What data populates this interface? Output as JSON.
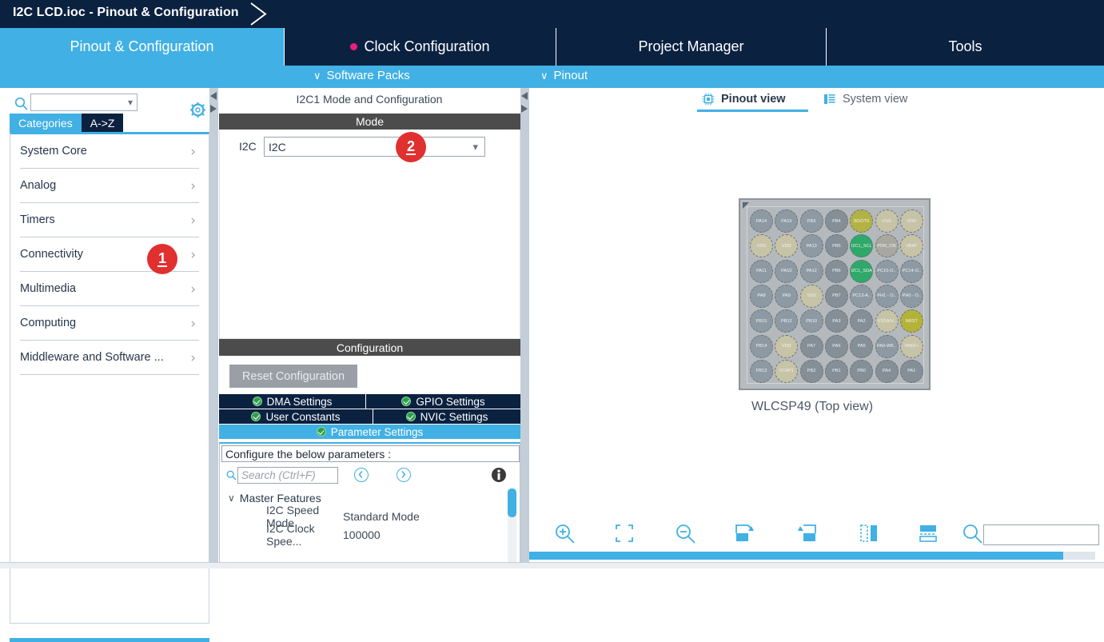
{
  "window": {
    "title": "I2C LCD.ioc - Pinout & Configuration"
  },
  "main_tabs": [
    {
      "label": "Pinout & Configuration",
      "active": true,
      "dot": false
    },
    {
      "label": "Clock Configuration",
      "active": false,
      "dot": true
    },
    {
      "label": "Project Manager",
      "active": false,
      "dot": false
    },
    {
      "label": "Tools",
      "active": false,
      "dot": false
    }
  ],
  "sub_bar": {
    "items": [
      {
        "label": "Software Packs",
        "icon": "chevron-down-icon"
      },
      {
        "label": "Pinout",
        "icon": "chevron-down-icon"
      }
    ]
  },
  "sidebar": {
    "search": {
      "value": "",
      "placeholder": ""
    },
    "gear_icon": "gear-icon",
    "tabs": [
      {
        "label": "Categories",
        "active": true
      },
      {
        "label": "A->Z",
        "active": false
      }
    ],
    "categories": [
      {
        "label": "System Core"
      },
      {
        "label": "Analog"
      },
      {
        "label": "Timers"
      },
      {
        "label": "Connectivity"
      },
      {
        "label": "Multimedia"
      },
      {
        "label": "Computing"
      },
      {
        "label": "Middleware and Software ..."
      }
    ]
  },
  "middle": {
    "title": "I2C1 Mode and Configuration",
    "mode_header": "Mode",
    "mode_row": {
      "label": "I2C",
      "value": "I2C"
    },
    "configuration_header": "Configuration",
    "reset_button": "Reset Configuration",
    "config_tabs": [
      {
        "label": "DMA Settings",
        "active": false
      },
      {
        "label": "GPIO Settings",
        "active": false
      },
      {
        "label": "User Constants",
        "active": false
      },
      {
        "label": "NVIC Settings",
        "active": false
      },
      {
        "label": "Parameter Settings",
        "active": true
      }
    ],
    "configure_label": "Configure the below parameters :",
    "param_search": {
      "value": "",
      "placeholder": "Search (Ctrl+F)"
    },
    "param_tree": {
      "group": "Master Features",
      "rows": [
        {
          "name": "I2C Speed Mode",
          "value": "Standard Mode"
        },
        {
          "name": "I2C Clock Spee...",
          "value": "100000"
        }
      ]
    }
  },
  "right": {
    "view_tabs": [
      {
        "label": "Pinout view",
        "icon": "chip-icon",
        "active": true
      },
      {
        "label": "System view",
        "icon": "list-icon",
        "active": false
      }
    ],
    "chip_caption": "WLCSP49 (Top view)",
    "chip": {
      "rows": [
        [
          {
            "label": "PA14",
            "color": "#8e9aa3"
          },
          {
            "label": "PA15",
            "color": "#8e9aa3"
          },
          {
            "label": "PB3",
            "color": "#8e9aa3"
          },
          {
            "label": "PB4",
            "color": "#858f98"
          },
          {
            "label": "BOOT0",
            "color": "#b3b345"
          },
          {
            "label": "VSS",
            "color": "#c6c3a6"
          },
          {
            "label": "VDD",
            "color": "#c6c3a6"
          }
        ],
        [
          {
            "label": "VSS",
            "color": "#c6c3a6"
          },
          {
            "label": "VDD",
            "color": "#c6c3a6"
          },
          {
            "label": "PA13",
            "color": "#8e9aa3"
          },
          {
            "label": "PB5",
            "color": "#858f98"
          },
          {
            "label": "I2C1_SCL",
            "color": "#2fa869"
          },
          {
            "label": "PDR_ON",
            "color": "#a8a8a0"
          },
          {
            "label": "VBAT",
            "color": "#c6c3a6"
          }
        ],
        [
          {
            "label": "PA11",
            "color": "#8e9aa3"
          },
          {
            "label": "PA10",
            "color": "#8e9aa3"
          },
          {
            "label": "PA12",
            "color": "#8e9aa3"
          },
          {
            "label": "PB6",
            "color": "#858f98"
          },
          {
            "label": "I2C1_SDA",
            "color": "#2fa869"
          },
          {
            "label": "PC15-O..",
            "color": "#8e9aa3"
          },
          {
            "label": "PC14-O..",
            "color": "#8e9aa3"
          }
        ],
        [
          {
            "label": "PA8",
            "color": "#8e9aa3"
          },
          {
            "label": "PA9",
            "color": "#8e9aa3"
          },
          {
            "label": "VSS",
            "color": "#c6c3a6"
          },
          {
            "label": "PB7",
            "color": "#858f98"
          },
          {
            "label": "PC13-A..",
            "color": "#8e9aa3"
          },
          {
            "label": "PH1 - O..",
            "color": "#8e9aa3"
          },
          {
            "label": "PH0 - O..",
            "color": "#8e9aa3"
          }
        ],
        [
          {
            "label": "PB15",
            "color": "#8e9aa3"
          },
          {
            "label": "PB12",
            "color": "#8e9aa3"
          },
          {
            "label": "PB10",
            "color": "#8e9aa3"
          },
          {
            "label": "PA3",
            "color": "#858f98"
          },
          {
            "label": "PA2",
            "color": "#858f98"
          },
          {
            "label": "VSSA/V..",
            "color": "#c6c3a6"
          },
          {
            "label": "NRST",
            "color": "#b3b33a"
          }
        ],
        [
          {
            "label": "PB14",
            "color": "#8e9aa3"
          },
          {
            "label": "VDD",
            "color": "#c6c3a6"
          },
          {
            "label": "PA7",
            "color": "#858f98"
          },
          {
            "label": "PA6",
            "color": "#858f98"
          },
          {
            "label": "PA5",
            "color": "#858f98"
          },
          {
            "label": "PA0-WK..",
            "color": "#8e9aa3"
          },
          {
            "label": "VREF+",
            "color": "#c6c3a6"
          }
        ],
        [
          {
            "label": "PB13",
            "color": "#8e9aa3"
          },
          {
            "label": "VCAP1",
            "color": "#c6c3a6"
          },
          {
            "label": "PB2",
            "color": "#858f98"
          },
          {
            "label": "PB1",
            "color": "#858f98"
          },
          {
            "label": "PB0",
            "color": "#858f98"
          },
          {
            "label": "PA4",
            "color": "#858f98"
          },
          {
            "label": "PA1",
            "color": "#858f98"
          }
        ]
      ]
    },
    "toolbar_icons": [
      "zoom-in-icon",
      "fit-to-screen-icon",
      "zoom-out-icon",
      "rotate-right-icon",
      "rotate-left-icon",
      "flip-horizontal-icon",
      "flip-vertical-icon",
      "search-icon"
    ],
    "toolbar_search": {
      "value": "",
      "placeholder": ""
    }
  },
  "badges": [
    {
      "number": "1"
    },
    {
      "number": "2"
    }
  ],
  "colors": {
    "navy": "#0b2140",
    "accent_blue": "#41b0e4",
    "header_grey": "#4c4c4c",
    "badge_red": "#e03030",
    "pink_dot": "#e8207a",
    "check_green": "#2e9e4b"
  }
}
